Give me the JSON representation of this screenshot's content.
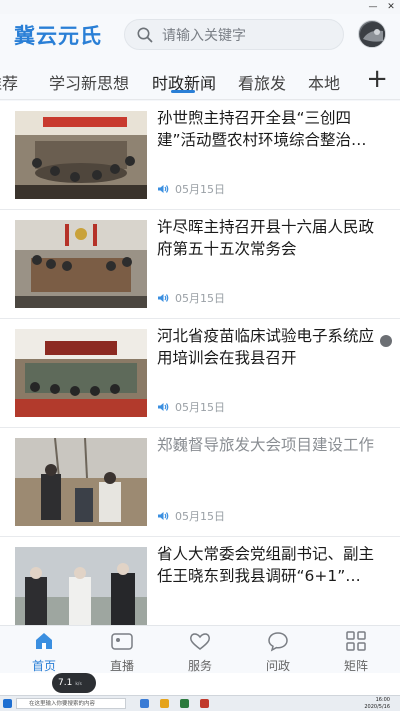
{
  "app": {
    "logo": "冀云元氏"
  },
  "search": {
    "placeholder": "请输入关键字"
  },
  "tabs": [
    {
      "label": "推荐"
    },
    {
      "label": "学习新思想"
    },
    {
      "label": "时政新闻",
      "active": true
    },
    {
      "label": "看旅发"
    },
    {
      "label": "本地"
    }
  ],
  "tab_add": "+",
  "news": [
    {
      "title": "孙世煦主持召开全县“三创四建”活动暨农村环境综合整治…",
      "date": "05月15日"
    },
    {
      "title": "许尽晖主持召开县十六届人民政府第五十五次常务会",
      "date": "05月15日"
    },
    {
      "title": "河北省疫苗临床试验电子系统应用培训会在我县召开",
      "date": "05月15日"
    },
    {
      "title": "郑巍督导旅发大会项目建设工作",
      "date": "05月15日",
      "visited": true
    },
    {
      "title": "省人大常委会党组副书记、副主任王晓东到我县调研“6+1”…",
      "date": ""
    }
  ],
  "bottom_nav": [
    {
      "label": "首页",
      "icon": "home-icon",
      "active": true
    },
    {
      "label": "直播",
      "icon": "live-camera-icon"
    },
    {
      "label": "服务",
      "icon": "service-heart-icon"
    },
    {
      "label": "问政",
      "icon": "chat-bubble-icon"
    },
    {
      "label": "矩阵",
      "icon": "matrix-grid-icon"
    }
  ],
  "overlay": {
    "speed": "7.1",
    "speed_unit": "k/s"
  },
  "taskbar": {
    "search_placeholder": "在这里输入你要搜索的内容",
    "time": "16:00",
    "date": "2020/5/16"
  },
  "colors": {
    "accent": "#2a7fd6",
    "text": "#1a1a1a",
    "muted": "#9aa0a6"
  }
}
